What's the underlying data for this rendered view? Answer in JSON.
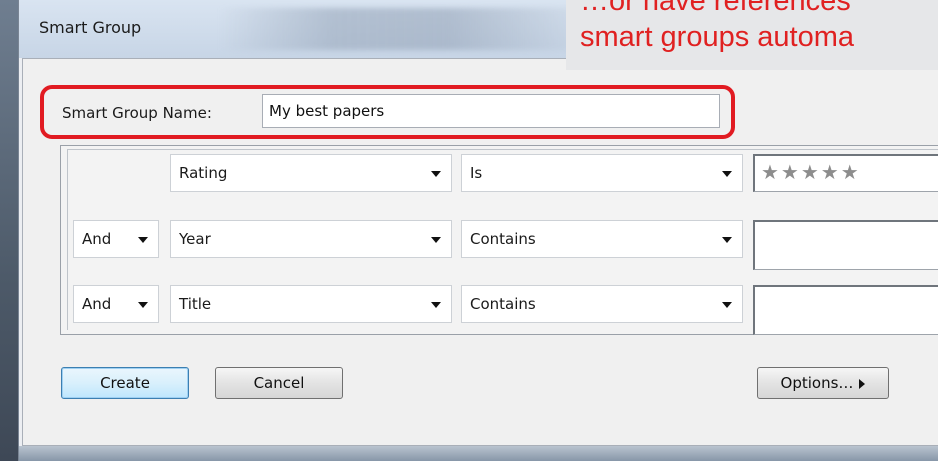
{
  "window": {
    "title": "Smart Group"
  },
  "caption": {
    "line1": "…or have references",
    "line2": "smart groups automa"
  },
  "form": {
    "name_label": "Smart Group Name:",
    "name_value": "My best papers"
  },
  "criteria": [
    {
      "connector": "",
      "field": "Rating",
      "operator": "Is",
      "value": "★★★★★",
      "value_kind": "rating"
    },
    {
      "connector": "And",
      "field": "Year",
      "operator": "Contains",
      "value": "",
      "value_kind": "text"
    },
    {
      "connector": "And",
      "field": "Title",
      "operator": "Contains",
      "value": "",
      "value_kind": "text"
    }
  ],
  "buttons": {
    "create": "Create",
    "cancel": "Cancel",
    "options": "Options…"
  },
  "colors": {
    "highlight": "#e11b22",
    "caption_text": "#e02121",
    "default_button_border": "#3c7fb1"
  },
  "icons": {
    "dropdown": "chevron-down-icon",
    "options_arrow": "triangle-right-icon"
  }
}
